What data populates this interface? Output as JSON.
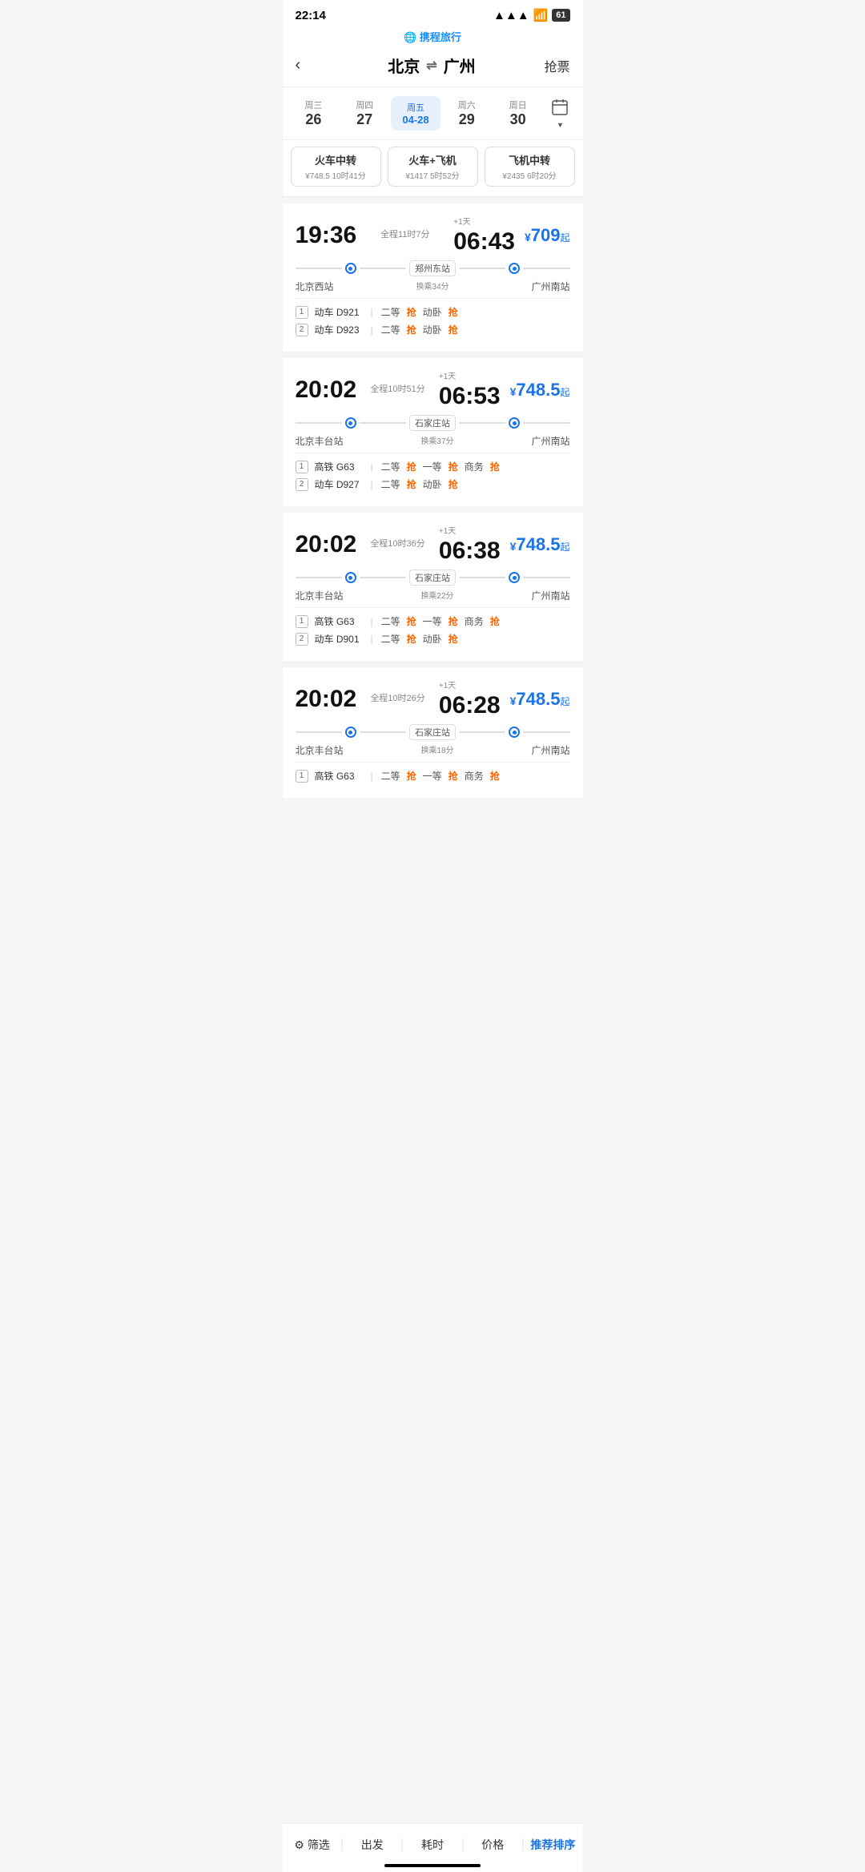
{
  "statusBar": {
    "time": "22:14",
    "battery": "61"
  },
  "appLogo": "✈携程旅行",
  "header": {
    "backLabel": "‹",
    "fromCity": "北京",
    "arrows": "⇌",
    "toCity": "广州",
    "grabTicket": "抢票"
  },
  "dateTabs": [
    {
      "weekday": "周三",
      "day": "26",
      "active": false
    },
    {
      "weekday": "周四",
      "day": "27",
      "active": false
    },
    {
      "weekday": "周五",
      "day": "04-28",
      "active": true,
      "isMonthDay": true
    },
    {
      "weekday": "周六",
      "day": "29",
      "active": false
    },
    {
      "weekday": "周日",
      "day": "30",
      "active": false
    }
  ],
  "transferTabs": [
    {
      "name": "火车中转",
      "info": "¥748.5 10时41分",
      "selected": false
    },
    {
      "name": "火车+飞机",
      "info": "¥1417 5时52分",
      "selected": false
    },
    {
      "name": "飞机中转",
      "info": "¥2435 6时20分",
      "selected": false
    }
  ],
  "trips": [
    {
      "departTime": "19:36",
      "duration": "全程11时7分",
      "arriveTime": "06:43",
      "nextDay": "+1天",
      "price": "709",
      "transferStation": "郑州东站",
      "transferWait": "换乘34分",
      "fromStation": "北京西站",
      "toStation": "广州南站",
      "trains": [
        {
          "num": "1",
          "name": "动车 D921",
          "seats": [
            {
              "type": "二等",
              "avail": "抢"
            },
            {
              "type": "动卧",
              "avail": "抢"
            }
          ]
        },
        {
          "num": "2",
          "name": "动车 D923",
          "seats": [
            {
              "type": "二等",
              "avail": "抢"
            },
            {
              "type": "动卧",
              "avail": "抢"
            }
          ]
        }
      ]
    },
    {
      "departTime": "20:02",
      "duration": "全程10时51分",
      "arriveTime": "06:53",
      "nextDay": "+1天",
      "price": "748.5",
      "transferStation": "石家庄站",
      "transferWait": "换乘37分",
      "fromStation": "北京丰台站",
      "toStation": "广州南站",
      "trains": [
        {
          "num": "1",
          "name": "高铁 G63",
          "seats": [
            {
              "type": "二等",
              "avail": "抢"
            },
            {
              "type": "一等",
              "avail": "抢"
            },
            {
              "type": "商务",
              "avail": "抢"
            }
          ]
        },
        {
          "num": "2",
          "name": "动车 D927",
          "seats": [
            {
              "type": "二等",
              "avail": "抢"
            },
            {
              "type": "动卧",
              "avail": "抢"
            }
          ]
        }
      ]
    },
    {
      "departTime": "20:02",
      "duration": "全程10时36分",
      "arriveTime": "06:38",
      "nextDay": "+1天",
      "price": "748.5",
      "transferStation": "石家庄站",
      "transferWait": "换乘22分",
      "fromStation": "北京丰台站",
      "toStation": "广州南站",
      "trains": [
        {
          "num": "1",
          "name": "高铁 G63",
          "seats": [
            {
              "type": "二等",
              "avail": "抢"
            },
            {
              "type": "一等",
              "avail": "抢"
            },
            {
              "type": "商务",
              "avail": "抢"
            }
          ]
        },
        {
          "num": "2",
          "name": "动车 D901",
          "seats": [
            {
              "type": "二等",
              "avail": "抢"
            },
            {
              "type": "动卧",
              "avail": "抢"
            }
          ]
        }
      ]
    },
    {
      "departTime": "20:02",
      "duration": "全程10时26分",
      "arriveTime": "06:28",
      "nextDay": "+1天",
      "price": "748.5",
      "transferStation": "石家庄站",
      "transferWait": "换乘18分",
      "fromStation": "北京丰台站",
      "toStation": "广州南站",
      "trains": [
        {
          "num": "1",
          "name": "高铁 G63",
          "seats": [
            {
              "type": "二等",
              "avail": "抢"
            },
            {
              "type": "一等",
              "avail": "抢"
            },
            {
              "type": "商务",
              "avail": "抢"
            }
          ]
        }
      ]
    }
  ],
  "bottomNav": [
    {
      "label": "筛选",
      "active": false,
      "hasIcon": true
    },
    {
      "label": "出发",
      "active": false
    },
    {
      "label": "耗时",
      "active": false
    },
    {
      "label": "价格",
      "active": false
    },
    {
      "label": "推荐排序",
      "active": true
    }
  ]
}
